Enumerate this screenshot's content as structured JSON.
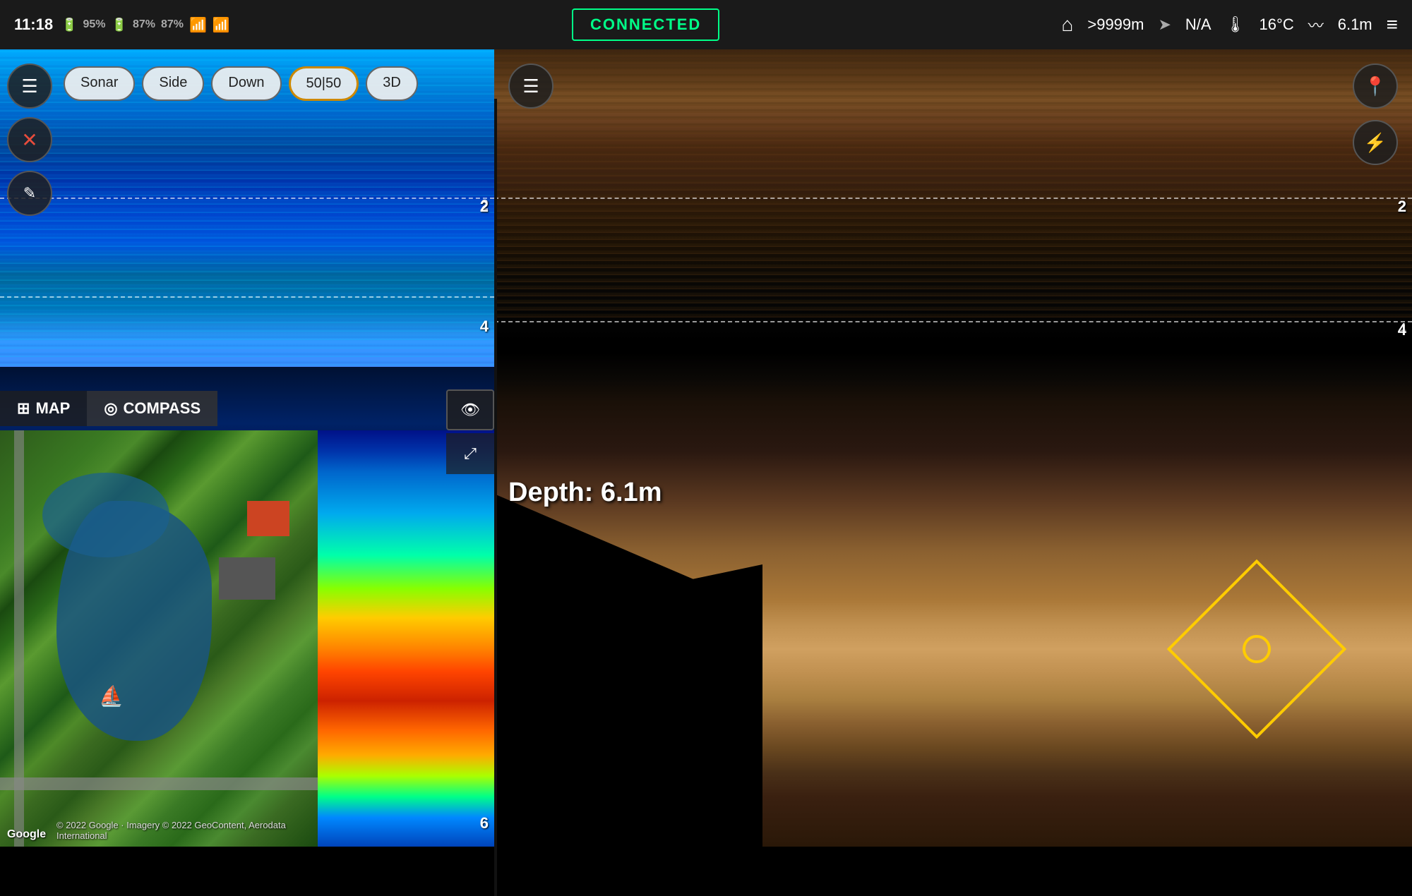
{
  "statusBar": {
    "time": "11:18",
    "battery1": "95%",
    "battery2": "87%",
    "battery3": "87%",
    "connectedLabel": "CONNECTED",
    "distance": ">9999m",
    "heading": "N/A",
    "temperature": "16°C",
    "depth": "6.1m"
  },
  "leftPanel": {
    "title": "Sonar",
    "depthText": "Depth:  6.1m",
    "depthValue": "6.1m",
    "viewButtons": [
      "Sonar",
      "Side",
      "Down",
      "50|50",
      "3D"
    ],
    "activeButton": "50|50",
    "scaleMarkers": [
      "2",
      "4",
      "6"
    ],
    "mapTab": "MAP",
    "compassTab": "COMPASS",
    "googleLabel": "Google",
    "copyright": "© 2022 Google · Imagery © 2022 GeoContent, Aerodata International"
  },
  "rightPanel": {
    "depthText": "Depth:  6.1m",
    "scaleMarkers": [
      "2",
      "4"
    ]
  },
  "icons": {
    "menu": "☰",
    "close": "✕",
    "edit": "✎",
    "map": "⊞",
    "compass": "◎",
    "binoculars": "👁",
    "expand": "⤢",
    "pin": "📍",
    "flash": "⚡",
    "boat": "⛵",
    "home": "⌂",
    "navigation": "➤",
    "temperature": "🌡",
    "signal": "📶",
    "hamburger": "≡"
  }
}
